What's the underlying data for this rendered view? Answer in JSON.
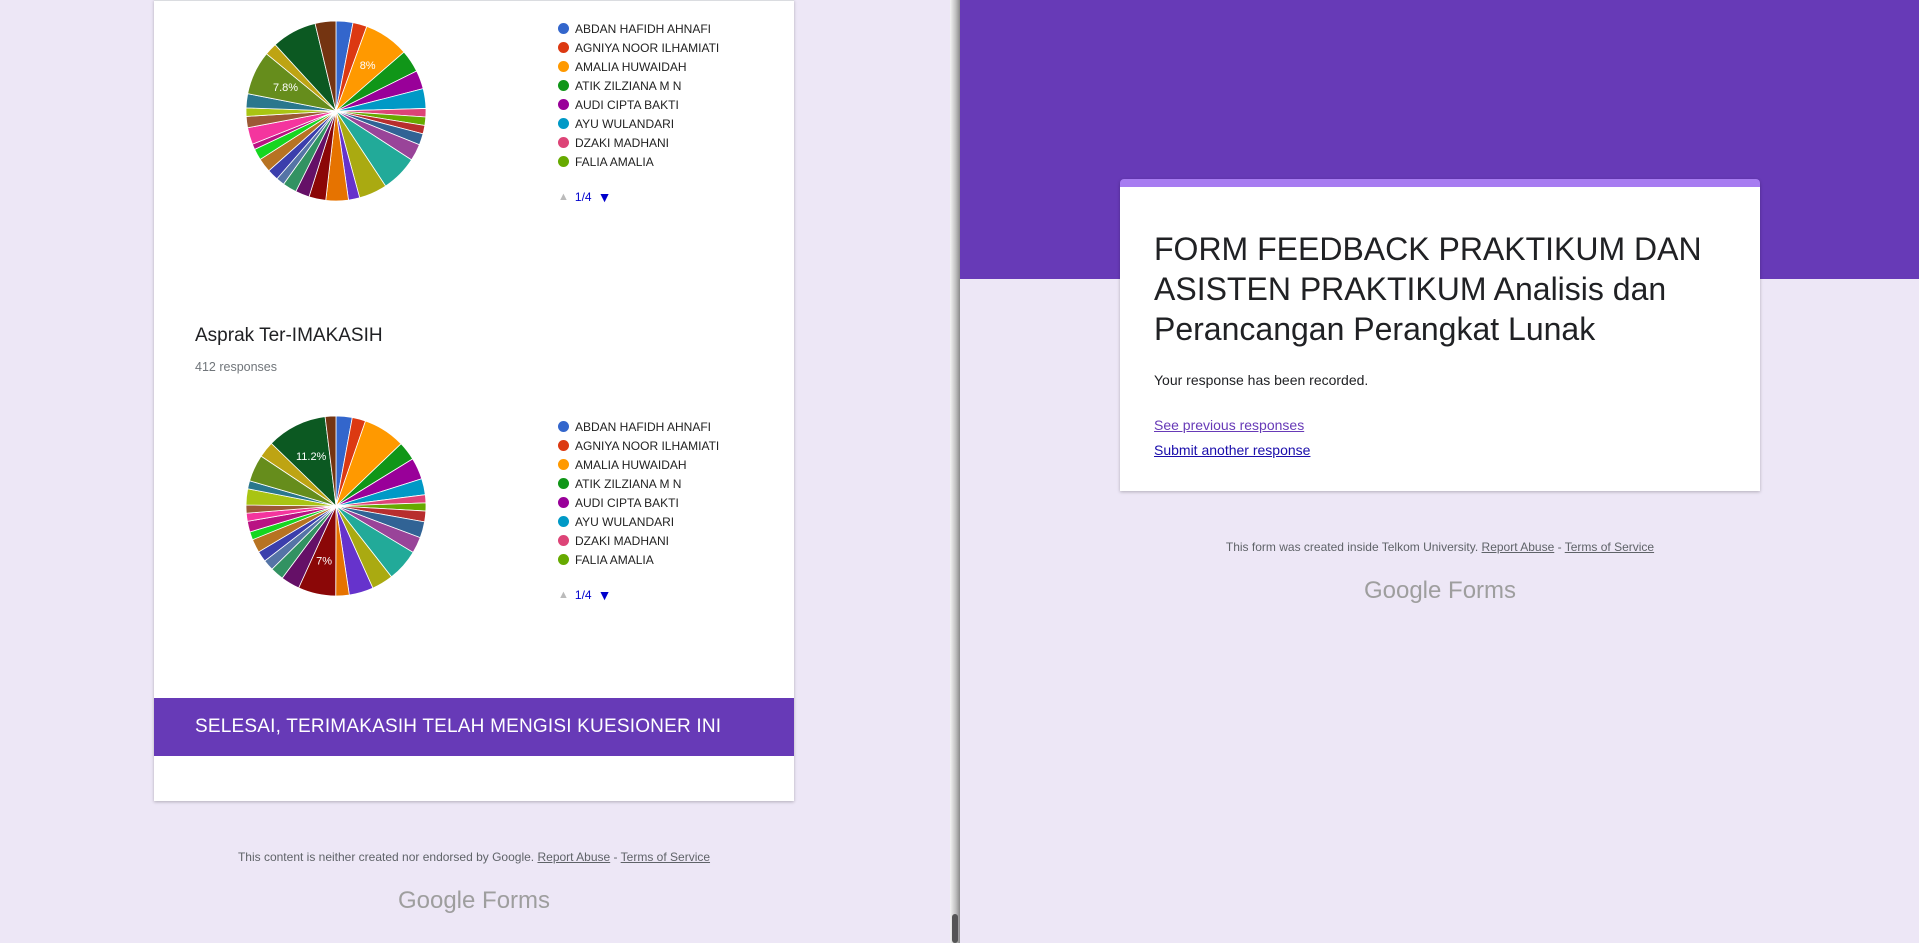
{
  "charts": [
    {
      "pie_labels": [
        "8%",
        "7.8%"
      ],
      "pager": {
        "page": "1/4"
      }
    },
    {
      "title": "Asprak Ter-IMAKASIH",
      "responses": "412 responses",
      "pie_labels": [
        "11.2%",
        "7%"
      ],
      "pager": {
        "page": "1/4"
      }
    }
  ],
  "chart_data": [
    {
      "type": "pie",
      "title": "",
      "legend_position": "right",
      "categories": [
        "ABDAN HAFIDH AHNAFI",
        "AGNIYA NOOR ILHAMIATI",
        "AMALIA HUWAIDAH",
        "ATIK ZILZIANA M N",
        "AUDI CIPTA BAKTI",
        "AYU WULANDARI",
        "DZAKI MADHANI",
        "FALIA AMALIA"
      ],
      "labeled_slices": [
        8,
        7.8
      ],
      "values": [
        3,
        2.5,
        8,
        4,
        3.3,
        3.5,
        1.5,
        1.5,
        1.5,
        2,
        3,
        6.5,
        5,
        2,
        4,
        3,
        2.5,
        2.5,
        1.5,
        2,
        2.5,
        2,
        1,
        3,
        2,
        1.5,
        2.5,
        7.8,
        2.2,
        8,
        3.7
      ]
    },
    {
      "type": "pie",
      "title": "Asprak Ter-IMAKASIH",
      "legend_position": "right",
      "categories": [
        "ABDAN HAFIDH AHNAFI",
        "AGNIYA NOOR ILHAMIATI",
        "AMALIA HUWAIDAH",
        "ATIK ZILZIANA M N",
        "AUDI CIPTA BAKTI",
        "AYU WULANDARI",
        "DZAKI MADHANI",
        "FALIA AMALIA"
      ],
      "labeled_slices": [
        11.2,
        7
      ],
      "values": [
        3,
        2.5,
        7.8,
        3.5,
        4,
        3,
        1.5,
        1.5,
        2,
        3,
        3,
        6,
        4,
        4.5,
        2.5,
        7,
        3.5,
        2.5,
        2,
        2,
        2.5,
        1.5,
        2,
        1.5,
        1.5,
        3,
        1.5,
        5,
        3,
        11.2,
        2
      ]
    }
  ],
  "colors": {
    "slices": [
      "#3366cc",
      "#dc3912",
      "#ff9900",
      "#109618",
      "#990099",
      "#0099c6",
      "#dd4477",
      "#66aa00",
      "#b82e2e",
      "#316395",
      "#994499",
      "#22aa99",
      "#aaaa11",
      "#6633cc",
      "#e67300",
      "#8b0707",
      "#651067",
      "#329262",
      "#5574a6",
      "#3b3eac",
      "#b77322",
      "#16d620",
      "#b91383",
      "#f4359e",
      "#9c5935",
      "#a9c413",
      "#2a778d",
      "#668d1c",
      "#bea413",
      "#0c5922",
      "#743411"
    ],
    "legend": [
      "#3366cc",
      "#dc3912",
      "#ff9900",
      "#109618",
      "#990099",
      "#0099c6",
      "#dd4477",
      "#66aa00"
    ]
  },
  "section_banner": "SELESAI, TERIMAKASIH TELAH MENGISI KUESIONER INI",
  "footer_left": {
    "text": "This content is neither created nor endorsed by Google.",
    "report": "Report Abuse",
    "sep": "-",
    "terms": "Terms of Service"
  },
  "logo": {
    "google": "Google",
    "forms": "Forms"
  },
  "confirmation": {
    "title": "FORM FEEDBACK PRAKTIKUM DAN ASISTEN PRAKTIKUM Analisis dan Perancangan Perangkat Lunak",
    "message": "Your response has been recorded.",
    "link_previous": "See previous responses",
    "link_another": "Submit another response"
  },
  "footer_right": {
    "text": "This form was created inside Telkom University.",
    "report": "Report Abuse",
    "sep": "-",
    "terms": "Terms of Service"
  }
}
